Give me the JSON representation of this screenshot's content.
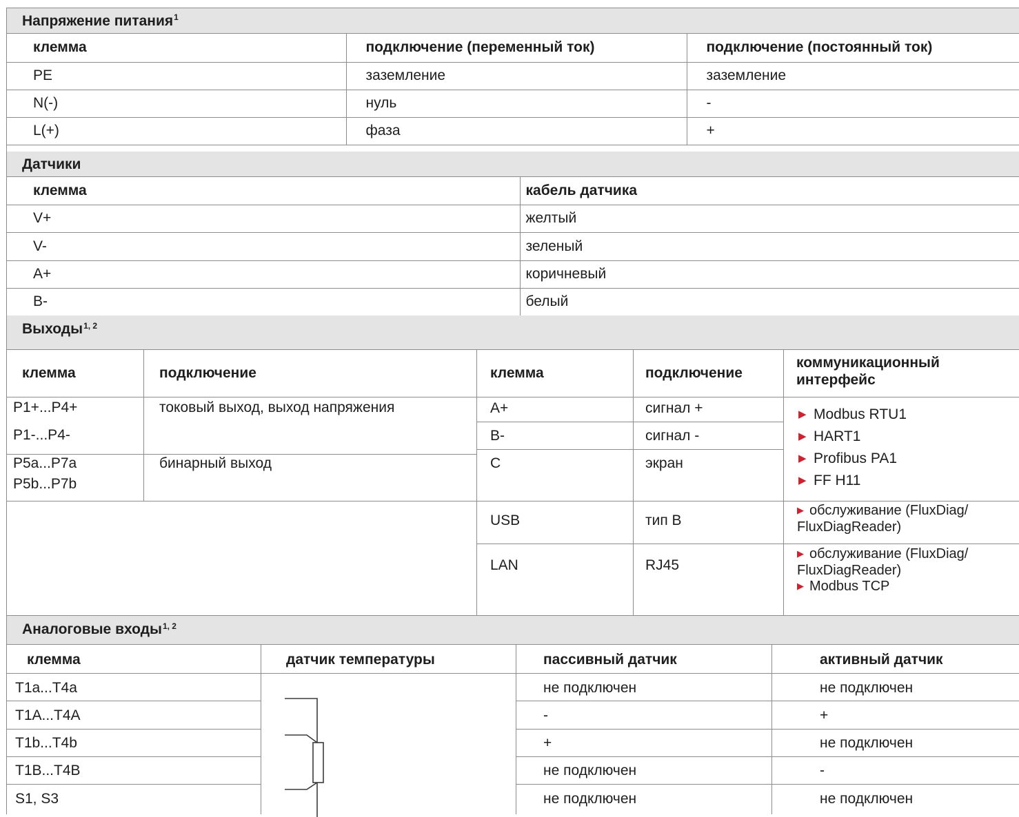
{
  "power": {
    "title": "Напряжение питания",
    "title_sup": "1",
    "headers": [
      "клемма",
      "подключение (переменный ток)",
      "подключение (постоянный ток)"
    ],
    "rows": [
      [
        "PE",
        "заземление",
        "заземление"
      ],
      [
        "N(-)",
        "нуль",
        "-"
      ],
      [
        "L(+)",
        "фаза",
        "+"
      ]
    ]
  },
  "sensors": {
    "title": "Датчики",
    "headers": [
      "клемма",
      "кабель датчика"
    ],
    "rows": [
      [
        "V+",
        "желтый"
      ],
      [
        "V-",
        "зеленый"
      ],
      [
        "A+",
        "коричневый"
      ],
      [
        "B-",
        "белый"
      ]
    ]
  },
  "outputs": {
    "title": "Выходы",
    "title_sup": "1, 2",
    "headers": [
      "клемма",
      "подключение",
      "клемма",
      "подключение",
      "коммуникационный интерфейс"
    ],
    "left_rows": [
      {
        "terminal_1": "P1+...P4+",
        "terminal_2": "P1-...P4-",
        "connection": "токовый выход, выход напряжения"
      },
      {
        "terminal_1": "P5a...P7a",
        "terminal_2": "P5b...P7b",
        "connection": "бинарный выход"
      }
    ],
    "right_rows": [
      {
        "terminal": "A+",
        "connection": "сигнал +"
      },
      {
        "terminal": "B-",
        "connection": "сигнал -"
      },
      {
        "terminal": "C",
        "connection": "экран"
      }
    ],
    "interfaces": [
      "Modbus RTU1",
      "HART1",
      "Profibus PA1",
      "FF H11"
    ],
    "usb": {
      "terminal": "USB",
      "connection": "тип B",
      "iface_1": "обслуживание (FluxDiag/",
      "iface_2": "FluxDiagReader)"
    },
    "lan": {
      "terminal": "LAN",
      "connection": "RJ45",
      "iface_1": "обслуживание (FluxDiag/",
      "iface_2": "FluxDiagReader)",
      "iface_3": "Modbus TCP"
    }
  },
  "analog": {
    "title": "Аналоговые входы",
    "title_sup": "1, 2",
    "headers": [
      "клемма",
      "датчик температуры",
      "пассивный датчик",
      "активный датчик"
    ],
    "rows": [
      [
        "T1a...T4a",
        "не подключен",
        "не подключен"
      ],
      [
        "T1A...T4A",
        "-",
        "+"
      ],
      [
        "T1b...T4b",
        "+",
        "не подключен"
      ],
      [
        "T1B...T4B",
        "не подключен",
        "-"
      ],
      [
        "S1, S3",
        "не подключен",
        "не подключен"
      ]
    ]
  },
  "colors": {
    "header_bg": "#e4e4e4",
    "grid": "#8c8c8c",
    "bullet": "#d2202e"
  }
}
